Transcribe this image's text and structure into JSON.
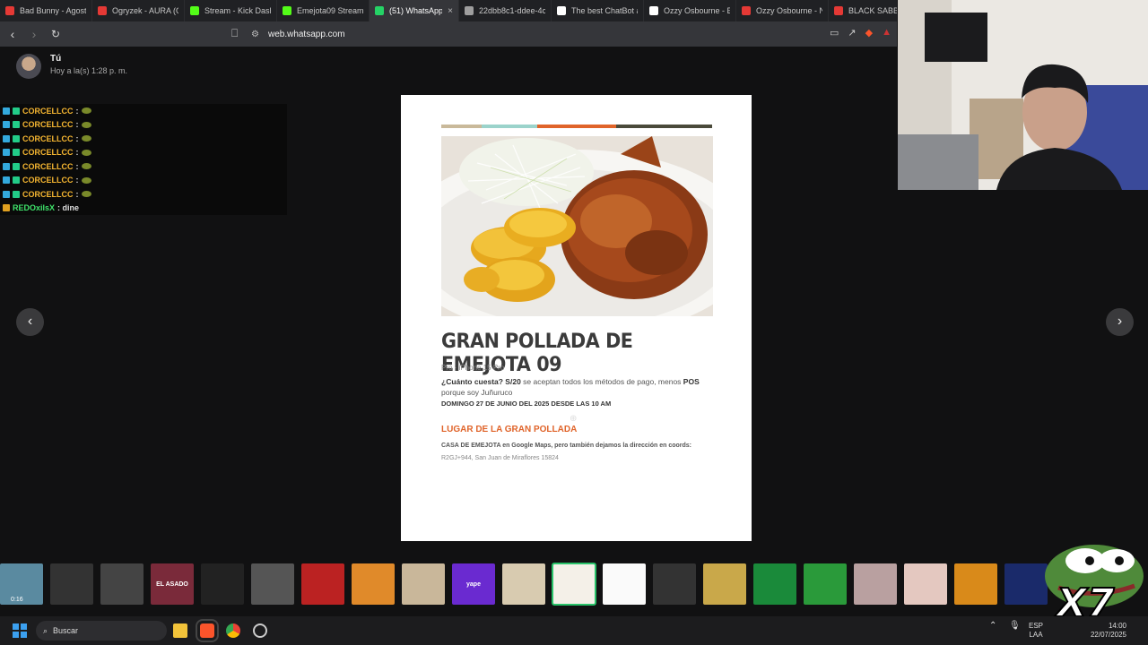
{
  "tabs": [
    {
      "title": "Bad Bunny - Agosto",
      "fav_color": "#e53935",
      "active": false
    },
    {
      "title": "Ogryzek - AURA (O",
      "fav_color": "#e53935",
      "active": false
    },
    {
      "title": "Stream - Kick Dashb",
      "fav_color": "#53fc18",
      "active": false
    },
    {
      "title": "Emejota09 Stream",
      "fav_color": "#53fc18",
      "active": false
    },
    {
      "title": "(51) WhatsApp",
      "fav_color": "#25d366",
      "active": true
    },
    {
      "title": "22dbb8c1-ddee-4c",
      "fav_color": "#9e9e9e",
      "active": false
    },
    {
      "title": "The best ChatBot ar",
      "fav_color": "#ffffff",
      "active": false
    },
    {
      "title": "Ozzy Osbourne - B",
      "fav_color": "#ffffff",
      "active": false
    },
    {
      "title": "Ozzy Osbourne - N",
      "fav_color": "#e53935",
      "active": false
    },
    {
      "title": "BLACK SABB",
      "fav_color": "#e53935",
      "active": false
    }
  ],
  "address_bar": {
    "url": "web.whatsapp.com"
  },
  "viewer": {
    "sender": "Tú",
    "timestamp": "Hoy a la(s) 1:28 p. m."
  },
  "chat": {
    "messages": [
      {
        "user": "CORCELLCC",
        "text": ":"
      },
      {
        "user": "CORCELLCC",
        "text": ":"
      },
      {
        "user": "CORCELLCC",
        "text": ":"
      },
      {
        "user": "CORCELLCC",
        "text": ":"
      },
      {
        "user": "CORCELLCC",
        "text": ":"
      },
      {
        "user": "CORCELLCC",
        "text": ":"
      },
      {
        "user": "CORCELLCC",
        "text": ":"
      },
      {
        "user": "REDOxilsX",
        "text": ": dine"
      }
    ]
  },
  "document": {
    "title": "GRAN POLLADA DE EMEJOTA 09",
    "device": "Pro · iPhone 15 Pro",
    "price_q": "¿Cuánto cuesta? S/20",
    "price_mid": " se aceptan todos los métodos de pago, menos ",
    "price_pos": "POS",
    "price_end": " porque soy Juñuruco",
    "date": "DOMINGO 27 DE JUNIO DEL 2025 DESDE LAS 10 AM",
    "location_title": "LUGAR DE LA GRAN POLLADA",
    "location_desc": "CASA DE EMEJOTA en Google Maps, pero también dejamos la dirección en coords:",
    "coords": "R2GJ+944, San Juan de Miraflores 15824",
    "stripe_colors": [
      "#c9b99a",
      "#9bd3cb",
      "#e0642a",
      "#4a4a3a"
    ]
  },
  "thumbnails": {
    "duration": "0:16",
    "selected_index": 11,
    "colors": [
      "#5a8aa0",
      "#333",
      "#444",
      "#7a2a3a",
      "#222",
      "#555",
      "#b22",
      "#e08a2a",
      "#c9b79a",
      "#6a2ad0",
      "#d8cbb0",
      "#f4f0e8",
      "#fafafa",
      "#333",
      "#c9a84a",
      "#1a8a3a",
      "#2a9a3a",
      "#b9a0a0",
      "#e4c8c0",
      "#d98a1a",
      "#1a2a6a"
    ],
    "labels": [
      "",
      "",
      "",
      "EL ASADO",
      "",
      "",
      "",
      "",
      "",
      "yape",
      "",
      "",
      "",
      "",
      "",
      "",
      "",
      "",
      "",
      "",
      ""
    ]
  },
  "taskbar": {
    "search_placeholder": "Buscar",
    "lang_top": "ESP",
    "lang_bottom": "LAA",
    "time": "14:00",
    "date": "22/07/2025"
  },
  "overlay": {
    "multiplier": "X7"
  }
}
